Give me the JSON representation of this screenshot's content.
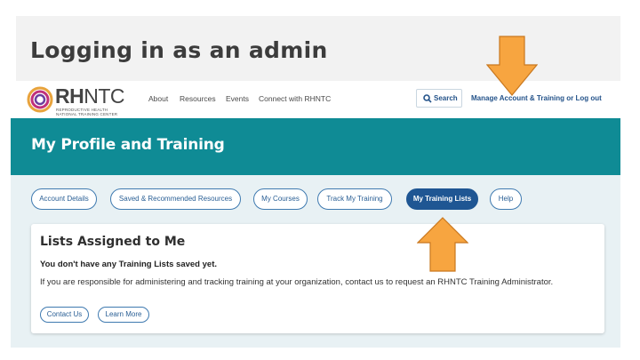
{
  "slide": {
    "title": "Logging in as an admin"
  },
  "site": {
    "logo": {
      "name_bold": "RH",
      "name_light": "NTC",
      "tagline_1": "REPRODUCTIVE HEALTH",
      "tagline_2": "NATIONAL TRAINING CENTER"
    },
    "nav": [
      {
        "label": "About"
      },
      {
        "label": "Resources"
      },
      {
        "label": "Events"
      },
      {
        "label": "Connect with RHNTC"
      }
    ],
    "search_label": "Search",
    "account_links": "Manage Account & Training or Log out"
  },
  "profile": {
    "title": "My Profile and Training",
    "tabs": [
      {
        "label": "Account Details"
      },
      {
        "label": "Saved & Recommended Resources"
      },
      {
        "label": "My Courses"
      },
      {
        "label": "Track My Training"
      },
      {
        "label": "My Training Lists",
        "active": true
      },
      {
        "label": "Help"
      }
    ],
    "card": {
      "title": "Lists Assigned to Me",
      "empty_message": "You don't have any Training Lists saved yet.",
      "body": "If you are responsible for administering and tracking training at your organization, contact us to request an RHNTC Training Administrator.",
      "buttons": [
        {
          "label": "Contact Us"
        },
        {
          "label": "Learn More"
        }
      ]
    }
  },
  "colors": {
    "teal": "#0f8b95",
    "navy": "#1f5693",
    "arrow_fill": "#f7a540",
    "arrow_stroke": "#c9781f"
  }
}
